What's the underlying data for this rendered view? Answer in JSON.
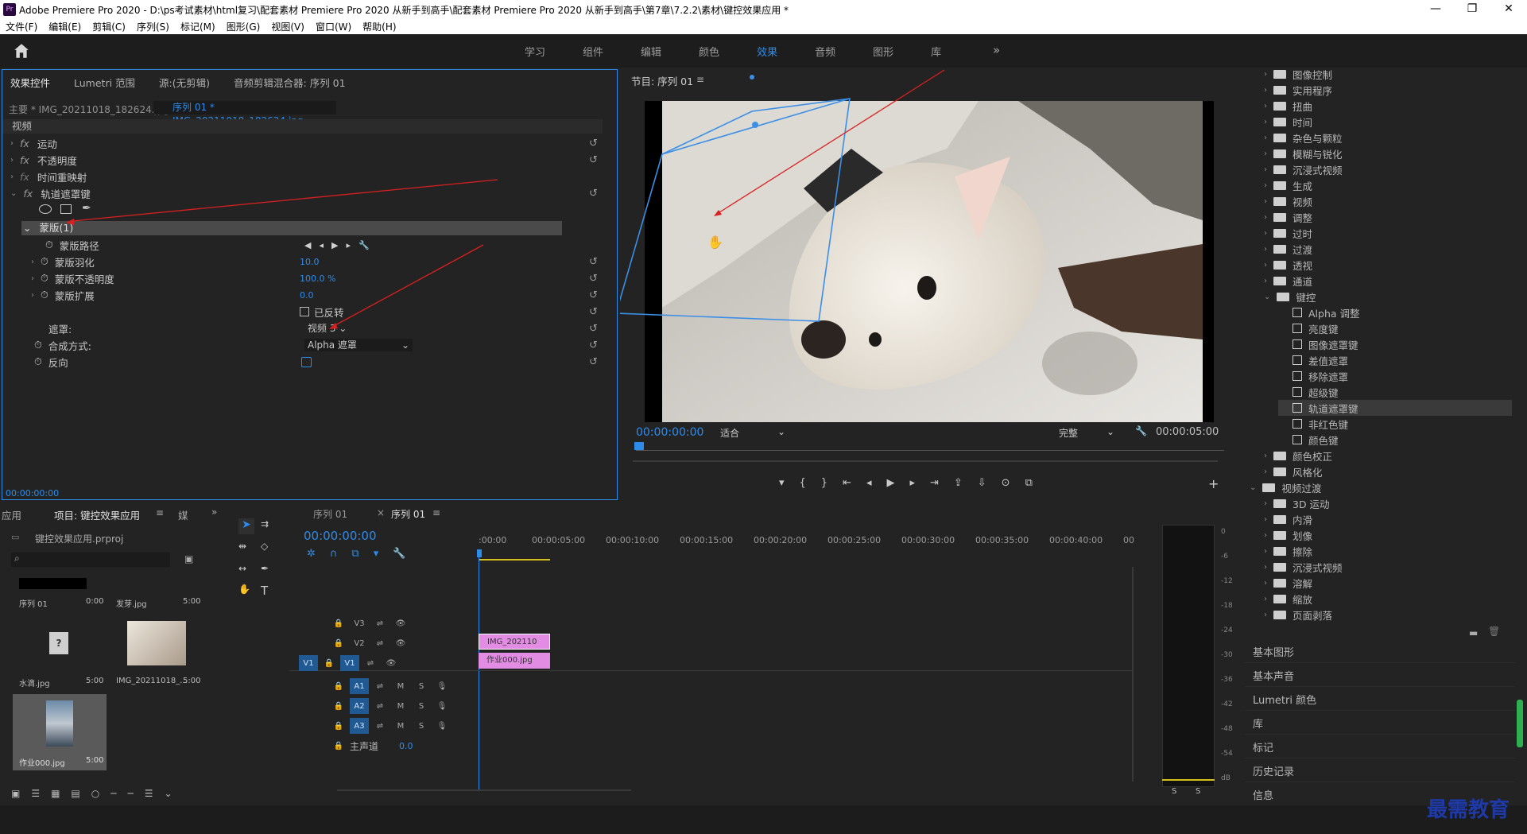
{
  "title": "Adobe Premiere Pro 2020 - D:\\ps考试素材\\html复习\\配套素材 Premiere Pro 2020 从新手到高手\\配套素材 Premiere Pro 2020 从新手到高手\\第7章\\7.2.2\\素材\\键控效果应用 *",
  "window_controls": [
    "—",
    "❐",
    "✕"
  ],
  "menu": [
    "文件(F)",
    "编辑(E)",
    "剪辑(C)",
    "序列(S)",
    "标记(M)",
    "图形(G)",
    "视图(V)",
    "窗口(W)",
    "帮助(H)"
  ],
  "workspaces": [
    "学习",
    "组件",
    "编辑",
    "颜色",
    "效果",
    "音频",
    "图形",
    "库"
  ],
  "active_workspace": "效果",
  "ec": {
    "tabs": [
      "效果控件",
      "Lumetri 范围",
      "源:(无剪辑)",
      "音频剪辑混合器: 序列 01"
    ],
    "master": "主要 * IMG_20211018_182624.jpg",
    "clip": "序列 01 * IMG_20211018_182624.jpg",
    "section": "视频",
    "motion": "运动",
    "opacity": "不透明度",
    "timeremap": "时间重映射",
    "trackmatte": "轨道遮罩键",
    "mask": "蒙版(1)",
    "maskpath": "蒙版路径",
    "feather": "蒙版羽化",
    "feather_val": "10.0",
    "maskopacity": "蒙版不透明度",
    "maskopacity_val": "100.0 %",
    "expansion": "蒙版扩展",
    "expansion_val": "0.0",
    "inverted": "已反转",
    "matte": "遮罩:",
    "matte_val": "视频 3",
    "composite": "合成方式:",
    "composite_val": "Alpha 遮罩",
    "reverse": "反向",
    "timecode": "00:00:00:00"
  },
  "program": {
    "title": "节目: 序列 01",
    "timecode": "00:00:00:00",
    "fit": "适合",
    "quality": "完整",
    "duration": "00:00:05:00"
  },
  "effects": [
    {
      "label": "图像控制",
      "lvl": 1,
      "t": "folder"
    },
    {
      "label": "实用程序",
      "lvl": 1,
      "t": "folder"
    },
    {
      "label": "扭曲",
      "lvl": 1,
      "t": "folder"
    },
    {
      "label": "时间",
      "lvl": 1,
      "t": "folder"
    },
    {
      "label": "杂色与颗粒",
      "lvl": 1,
      "t": "folder"
    },
    {
      "label": "模糊与锐化",
      "lvl": 1,
      "t": "folder"
    },
    {
      "label": "沉浸式视频",
      "lvl": 1,
      "t": "folder"
    },
    {
      "label": "生成",
      "lvl": 1,
      "t": "folder"
    },
    {
      "label": "视频",
      "lvl": 1,
      "t": "folder"
    },
    {
      "label": "调整",
      "lvl": 1,
      "t": "folder"
    },
    {
      "label": "过时",
      "lvl": 1,
      "t": "folder"
    },
    {
      "label": "过渡",
      "lvl": 1,
      "t": "folder"
    },
    {
      "label": "透视",
      "lvl": 1,
      "t": "folder"
    },
    {
      "label": "通道",
      "lvl": 1,
      "t": "folder"
    },
    {
      "label": "键控",
      "lvl": 1,
      "t": "open"
    },
    {
      "label": "Alpha 调整",
      "lvl": 2,
      "t": "fx"
    },
    {
      "label": "亮度键",
      "lvl": 2,
      "t": "fx"
    },
    {
      "label": "图像遮罩键",
      "lvl": 2,
      "t": "fx"
    },
    {
      "label": "差值遮罩",
      "lvl": 2,
      "t": "fx"
    },
    {
      "label": "移除遮罩",
      "lvl": 2,
      "t": "fx"
    },
    {
      "label": "超级键",
      "lvl": 2,
      "t": "fx"
    },
    {
      "label": "轨道遮罩键",
      "lvl": 2,
      "t": "fx",
      "sel": true
    },
    {
      "label": "非红色键",
      "lvl": 2,
      "t": "fx"
    },
    {
      "label": "颜色键",
      "lvl": 2,
      "t": "fx"
    },
    {
      "label": "颜色校正",
      "lvl": 1,
      "t": "folder"
    },
    {
      "label": "风格化",
      "lvl": 1,
      "t": "folder"
    },
    {
      "label": "视频过渡",
      "lvl": 0,
      "t": "open"
    },
    {
      "label": "3D 运动",
      "lvl": 1,
      "t": "folder"
    },
    {
      "label": "内滑",
      "lvl": 1,
      "t": "folder"
    },
    {
      "label": "划像",
      "lvl": 1,
      "t": "folder"
    },
    {
      "label": "擦除",
      "lvl": 1,
      "t": "folder"
    },
    {
      "label": "沉浸式视频",
      "lvl": 1,
      "t": "folder"
    },
    {
      "label": "溶解",
      "lvl": 1,
      "t": "folder"
    },
    {
      "label": "缩放",
      "lvl": 1,
      "t": "folder"
    },
    {
      "label": "页面剥落",
      "lvl": 1,
      "t": "folder"
    }
  ],
  "side_panels": [
    "基本图形",
    "基本声音",
    "Lumetri 颜色",
    "库",
    "标记",
    "历史记录",
    "信息"
  ],
  "project": {
    "tabs": [
      "应用",
      "项目: 键控效果应用",
      "媒"
    ],
    "file": "键控效果应用.prproj",
    "items": [
      {
        "name": "序列 01",
        "dur": "0:00"
      },
      {
        "name": "发芽.jpg",
        "dur": "5:00"
      },
      {
        "name": "水滴.jpg",
        "dur": "5:00"
      },
      {
        "name": "IMG_20211018_...",
        "dur": "5:00"
      },
      {
        "name": "作业000.jpg",
        "dur": "5:00"
      }
    ]
  },
  "timeline": {
    "tabs": [
      "序列 01",
      "序列 01"
    ],
    "timecode": "00:00:00:00",
    "ruler": [
      ":00:00",
      "00:00:05:00",
      "00:00:10:00",
      "00:00:15:00",
      "00:00:20:00",
      "00:00:25:00",
      "00:00:30:00",
      "00:00:35:00",
      "00:00:40:00",
      "00"
    ],
    "tracks": [
      "V3",
      "V2",
      "V1",
      "A1",
      "A2",
      "A3"
    ],
    "master": "主声道",
    "master_val": "0.0",
    "clips": [
      {
        "name": "IMG_202110",
        "track": "V2"
      },
      {
        "name": "作业000.jpg",
        "track": "V1"
      }
    ]
  },
  "meter": {
    "scale": [
      "0",
      "-6",
      "-12",
      "-18",
      "-24",
      "-30",
      "-36",
      "-42",
      "-48",
      "-54",
      "dB"
    ],
    "solo": [
      "S",
      "S"
    ]
  },
  "watermark": "最需教育",
  "colors": {
    "accent": "#2d8ceb",
    "clip": "#e38ce3",
    "bg": "#232323"
  }
}
